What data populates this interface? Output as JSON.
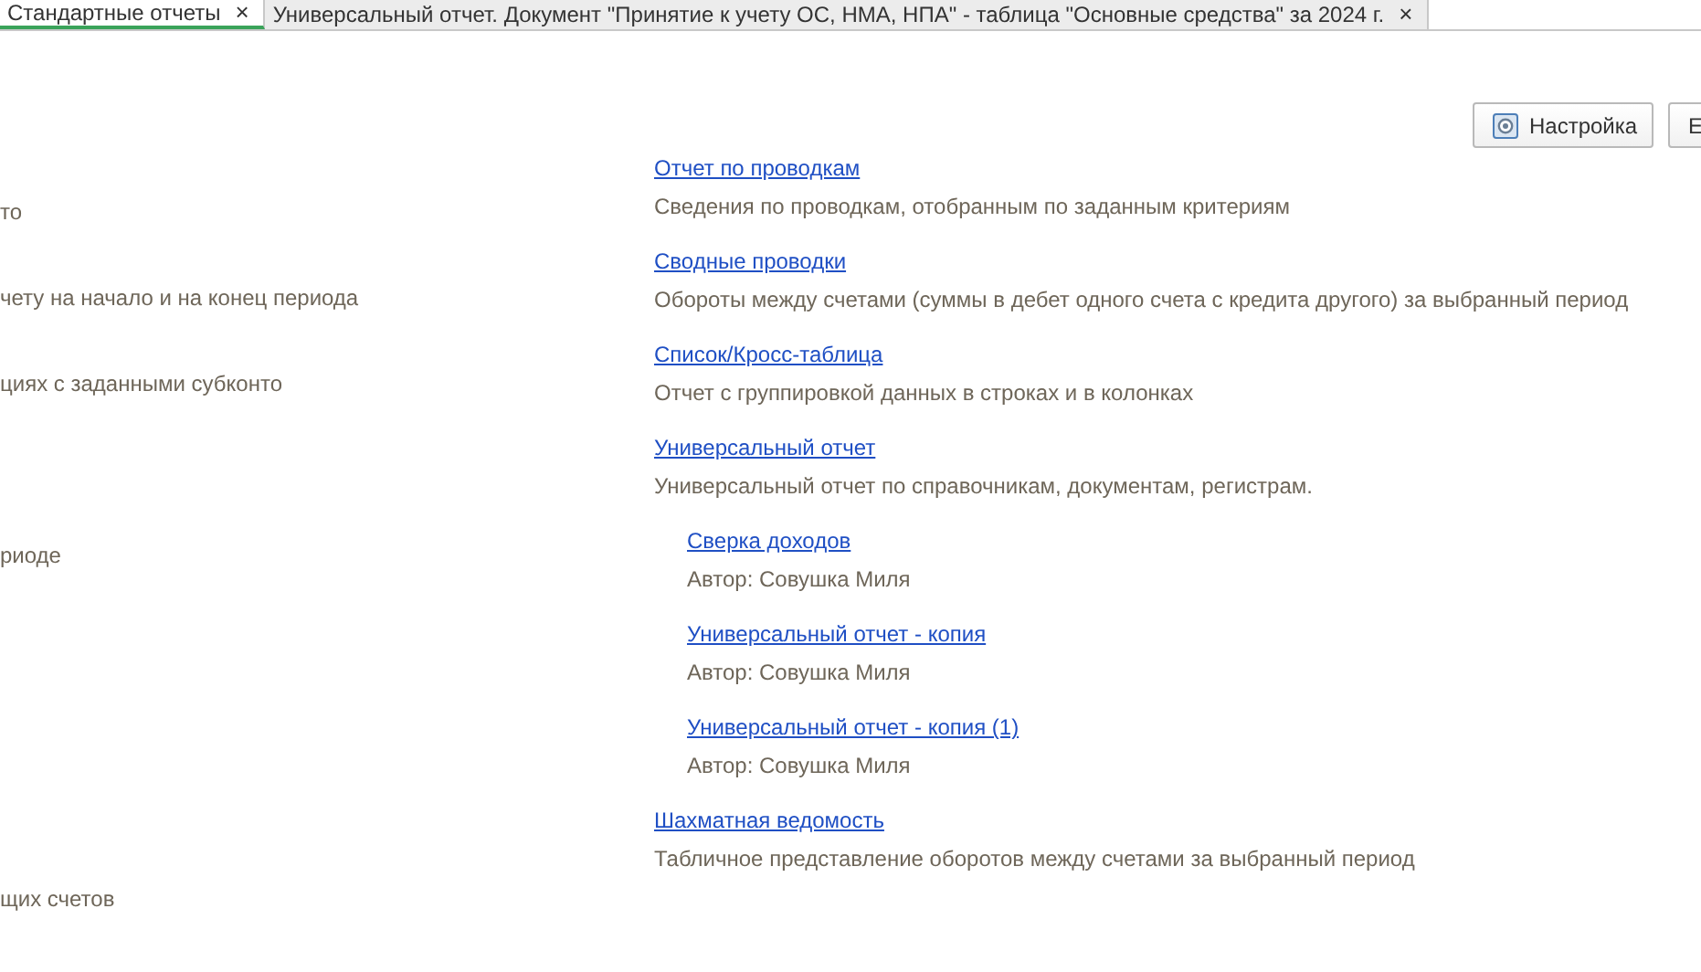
{
  "tabs": [
    {
      "label": "Стандартные отчеты",
      "selected": true,
      "close": "×"
    },
    {
      "label": "Универсальный отчет. Документ \"Принятие к учету ОС, НМА, НПА\" - таблица \"Основные средства\" за 2024 г.",
      "selected": false,
      "close": "×"
    }
  ],
  "toolbar": {
    "buttons": [
      {
        "label": "Настройка",
        "kind": "settings"
      },
      {
        "label": "Е",
        "kind": "plain"
      }
    ]
  },
  "left_column": [
    {
      "description": "то"
    },
    {
      "description": "чету на начало и на конец периода"
    },
    {
      "description": "циях с заданными субконто"
    },
    {
      "description": "риоде"
    },
    {
      "description": "щих счетов"
    }
  ],
  "right_column": [
    {
      "title": "Отчет по проводкам",
      "description": "Сведения по проводкам, отобранным по заданным критериям"
    },
    {
      "title": "Сводные проводки",
      "description": "Обороты между счетами (суммы в дебет одного счета с кредита другого) за выбранный период"
    },
    {
      "title": "Список/Кросс-таблица",
      "description": "Отчет с группировкой данных в строках и в колонках"
    },
    {
      "title": "Универсальный отчет",
      "description": "Универсальный отчет по справочникам, документам, регистрам.",
      "children": [
        {
          "title": "Сверка доходов",
          "description": "Автор: Совушка Миля"
        },
        {
          "title": "Универсальный отчет - копия",
          "description": "Автор: Совушка Миля"
        },
        {
          "title": "Универсальный отчет - копия (1)",
          "description": "Автор: Совушка Миля"
        }
      ]
    },
    {
      "title": "Шахматная ведомость",
      "description": "Табличное представление оборотов между счетами за выбранный период"
    }
  ]
}
